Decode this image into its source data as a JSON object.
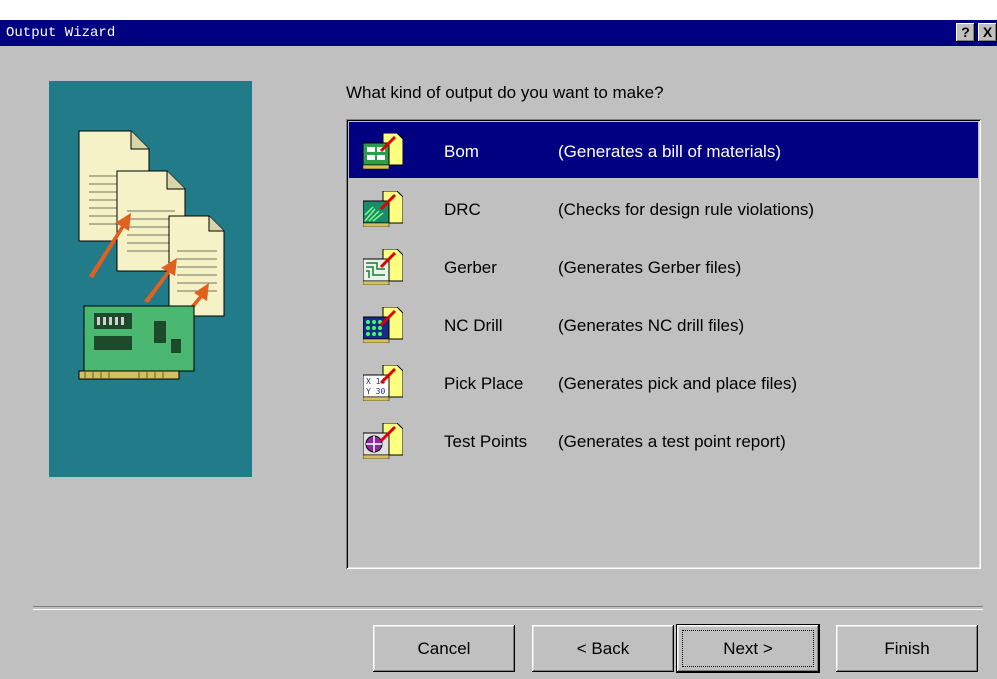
{
  "window": {
    "title": "Output Wizard",
    "help_label": "?",
    "close_label": "X"
  },
  "prompt": "What kind of output do you want to make?",
  "options": [
    {
      "name": "Bom",
      "description": "(Generates a bill of materials)",
      "icon": "bom-icon",
      "selected": true
    },
    {
      "name": "DRC",
      "description": "(Checks for design rule violations)",
      "icon": "drc-icon",
      "selected": false
    },
    {
      "name": "Gerber",
      "description": "(Generates Gerber files)",
      "icon": "gerber-icon",
      "selected": false
    },
    {
      "name": "NC Drill",
      "description": "(Generates NC drill files)",
      "icon": "nc-drill-icon",
      "selected": false
    },
    {
      "name": "Pick Place",
      "description": "(Generates pick and place files)",
      "icon": "pick-place-icon",
      "selected": false
    },
    {
      "name": "Test Points",
      "description": "(Generates a test point report)",
      "icon": "test-points-icon",
      "selected": false
    }
  ],
  "buttons": {
    "cancel": "Cancel",
    "back": "< Back",
    "next": "Next >",
    "finish": "Finish"
  },
  "colors": {
    "titlebar": "#000080",
    "selection": "#000080",
    "illustration_bg": "#227b88",
    "face": "#c0c0c0"
  }
}
